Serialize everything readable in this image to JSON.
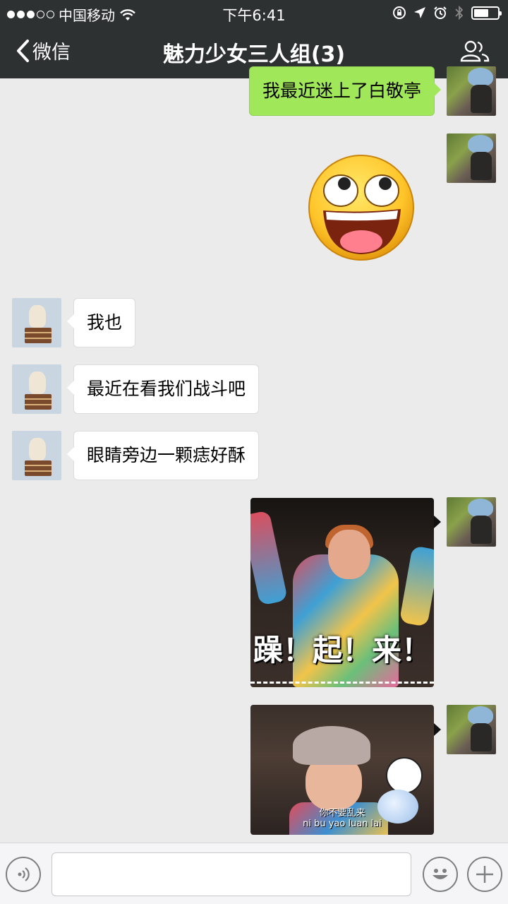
{
  "status_bar": {
    "carrier": "中国移动",
    "time": "下午6:41",
    "signal_icon": "signal-dots-icon",
    "wifi_icon": "wifi-icon"
  },
  "nav": {
    "back_label": "微信",
    "title": "魅力少女三人组(3)",
    "members_icon": "group-members-icon"
  },
  "messages": [
    {
      "from": "me",
      "type": "text",
      "text": "我最近迷上了白敬亭"
    },
    {
      "from": "me",
      "type": "emoji",
      "emoji": "laughing-face-emoji"
    },
    {
      "from": "friend",
      "type": "text",
      "text": "我也"
    },
    {
      "from": "friend",
      "type": "text",
      "text": "最近在看我们战斗吧"
    },
    {
      "from": "friend",
      "type": "text",
      "text": "眼睛旁边一颗痣好酥"
    },
    {
      "from": "me",
      "type": "sticker",
      "caption": "躁！起！来！"
    },
    {
      "from": "me",
      "type": "sticker",
      "caption": "你不要乱来",
      "pinyin": "ni bu yao luan lai"
    }
  ],
  "input_bar": {
    "placeholder": "",
    "voice_icon": "voice-icon",
    "emoji_icon": "emoji-icon",
    "plus_icon": "plus-icon"
  },
  "colors": {
    "header_bg": "#2e3132",
    "chat_bg": "#ebebeb",
    "outgoing_bubble": "#a0e75a",
    "incoming_bubble": "#ffffff"
  }
}
